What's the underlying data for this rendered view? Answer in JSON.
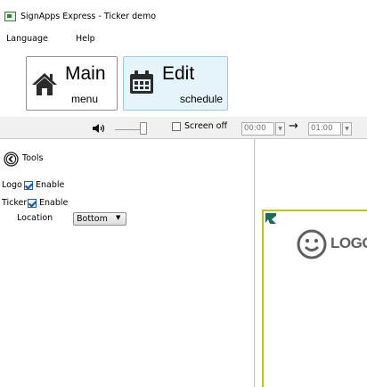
{
  "window": {
    "title": "SignApps Express - Ticker demo"
  },
  "menu": {
    "items": [
      {
        "label": "Language"
      },
      {
        "label": "Help"
      }
    ]
  },
  "ribbon": {
    "main_button": {
      "big": "Main",
      "small": "menu",
      "icon": "home-icon"
    },
    "edit_button": {
      "big": "Edit",
      "small": "schedule",
      "icon": "calendar-icon"
    }
  },
  "toolbar": {
    "volume_icon": "speaker-icon",
    "volume_level": 1.0,
    "screen_off_label": "Screen off",
    "screen_off_checked": false,
    "start_time": "00:00",
    "end_time": "01:00",
    "arrow": "→"
  },
  "tools": {
    "back_icon": "chevron-left-circle-icon",
    "header": "Tools",
    "logo_label": "Logo",
    "logo_enable_label": "Enable",
    "logo_enabled": true,
    "ticker_label": "Ticker",
    "ticker_enable_label": "Enable",
    "ticker_enabled": true,
    "location_label": "Location",
    "location_value": "Bottom"
  },
  "preview": {
    "logo_text": "LOGO",
    "accent_color": "#b6c817",
    "marker_color": "#1e6b5e"
  }
}
